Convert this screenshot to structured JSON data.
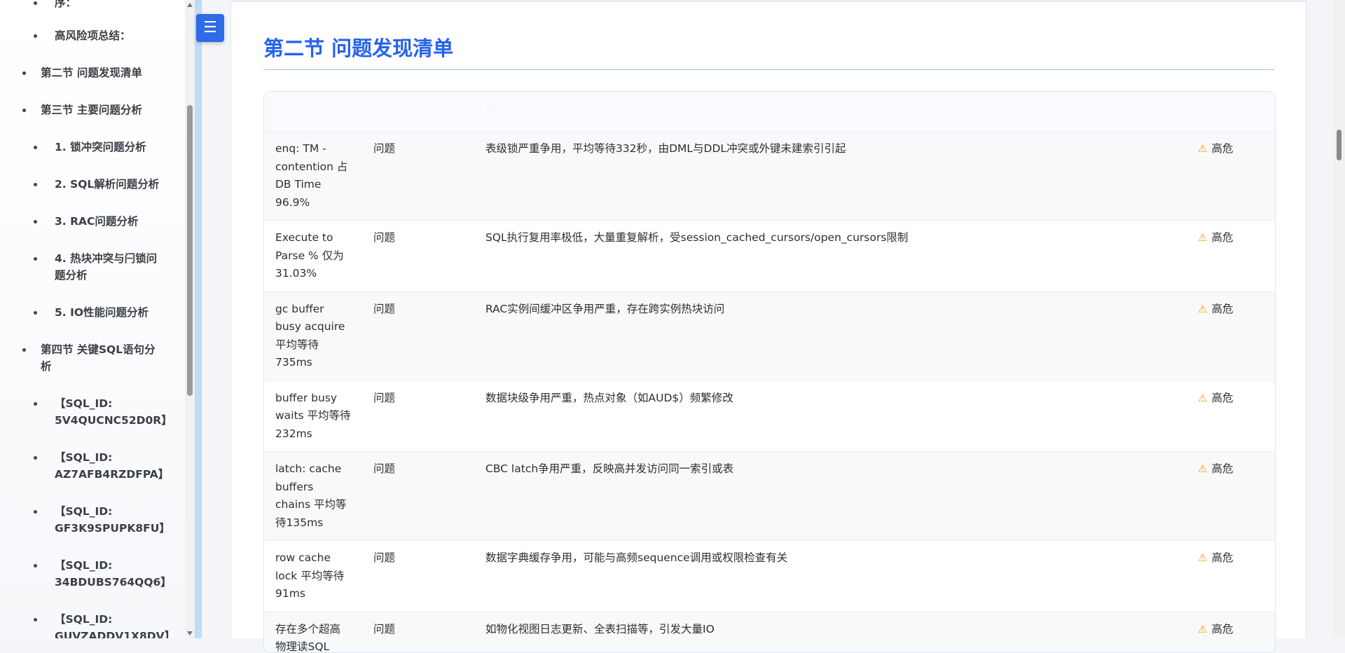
{
  "sidebar": {
    "items": [
      {
        "label": "序：",
        "level": 2
      },
      {
        "label": "高风险项总结：",
        "level": 2
      },
      {
        "label": "第二节 问题发现清单",
        "level": 1
      },
      {
        "label": "第三节 主要问题分析",
        "level": 1
      },
      {
        "label": "1. 锁冲突问题分析",
        "level": 2
      },
      {
        "label": "2. SQL解析问题分析",
        "level": 2
      },
      {
        "label": "3. RAC问题分析",
        "level": 2
      },
      {
        "label": "4. 热块冲突与闩锁问题分析",
        "level": 2
      },
      {
        "label": "5. IO性能问题分析",
        "level": 2
      },
      {
        "label": "第四节 关键SQL语句分析",
        "level": 1
      },
      {
        "label": "【SQL_ID: 5V4QUCNC52D0R】",
        "level": 2
      },
      {
        "label": "【SQL_ID: AZ7AFB4RZDFPA】",
        "level": 2
      },
      {
        "label": "【SQL_ID: GF3K9SPUPK8FU】",
        "level": 2
      },
      {
        "label": "【SQL_ID: 34BDUBS764QQ6】",
        "level": 2
      },
      {
        "label": "【SQL_ID: GUVZADDV1X8DV】",
        "level": 2
      }
    ]
  },
  "toggle": {
    "icon": "menu-icon",
    "glyph": "☰"
  },
  "main": {
    "section_title": "第二节 问题发现清单",
    "table": {
      "headers": [
        "现象",
        "问题类型",
        "原因分析",
        "风险等级"
      ],
      "rows": [
        {
          "symptom": "enq: TM - contention 占 DB Time 96.9%",
          "type": "问题",
          "reason": "表级锁严重争用，平均等待332秒，由DML与DDL冲突或外键未建索引引起",
          "risk": "高危"
        },
        {
          "symptom": "Execute to Parse % 仅为 31.03%",
          "type": "问题",
          "reason": "SQL执行复用率极低，大量重复解析，受session_cached_cursors/open_cursors限制",
          "risk": "高危"
        },
        {
          "symptom": "gc buffer busy acquire 平均等待735ms",
          "type": "问题",
          "reason": "RAC实例间缓冲区争用严重，存在跨实例热块访问",
          "risk": "高危"
        },
        {
          "symptom": "buffer busy waits 平均等待232ms",
          "type": "问题",
          "reason": "数据块级争用严重，热点对象（如AUD$）频繁修改",
          "risk": "高危"
        },
        {
          "symptom": "latch: cache buffers chains 平均等待135ms",
          "type": "问题",
          "reason": "CBC latch争用严重，反映高并发访问同一索引或表",
          "risk": "高危"
        },
        {
          "symptom": "row cache lock 平均等待91ms",
          "type": "问题",
          "reason": "数据字典缓存争用，可能与高频sequence调用或权限检查有关",
          "risk": "高危"
        },
        {
          "symptom": "存在多个超高物理读SQL",
          "type": "问题",
          "reason": "如物化视图日志更新、全表扫描等，引发大量IO",
          "risk": "高危"
        }
      ]
    },
    "colors": {
      "accent": "#2563eb",
      "warning": "#e8a317"
    }
  }
}
